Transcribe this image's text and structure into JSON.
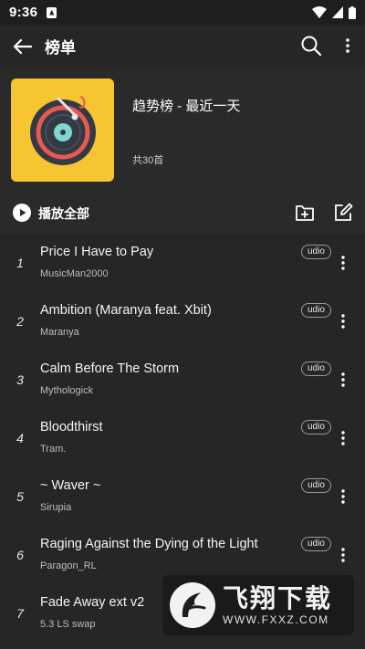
{
  "status_bar": {
    "time": "9:36"
  },
  "app_bar": {
    "title": "榜单"
  },
  "playlist": {
    "title": "趋势榜 - 最近一天",
    "count_label": "共30首",
    "cover": {
      "background": "#f6c532",
      "disc": "#333a44",
      "ring": "#e85a4f",
      "accent": "#7fd6d2"
    }
  },
  "actions": {
    "play_all_label": "播放全部"
  },
  "songs": [
    {
      "index": "1",
      "title": "Price I Have to Pay",
      "artist": "MusicMan2000",
      "source": "udio"
    },
    {
      "index": "2",
      "title": "Ambition (Maranya feat. Xbit)",
      "artist": "Maranya",
      "source": "udio"
    },
    {
      "index": "3",
      "title": "Calm Before The Storm",
      "artist": "Mythologick",
      "source": "udio"
    },
    {
      "index": "4",
      "title": "Bloodthirst",
      "artist": "Tram.",
      "source": "udio"
    },
    {
      "index": "5",
      "title": "~ Waver ~",
      "artist": "Sirupia",
      "source": "udio"
    },
    {
      "index": "6",
      "title": "Raging Against the Dying of the Light",
      "artist": "Paragon_RL",
      "source": "udio"
    },
    {
      "index": "7",
      "title": "Fade Away ext v2",
      "artist": "5.3 LS swap",
      "source": ""
    }
  ],
  "watermark": {
    "brand": "飞翔下载",
    "url": "WWW.FXXZ.COM"
  },
  "colors": {
    "background": "#262626",
    "card": "#2a2a2a",
    "text": "#f2f2f2",
    "subtext": "#bdbdbd"
  }
}
